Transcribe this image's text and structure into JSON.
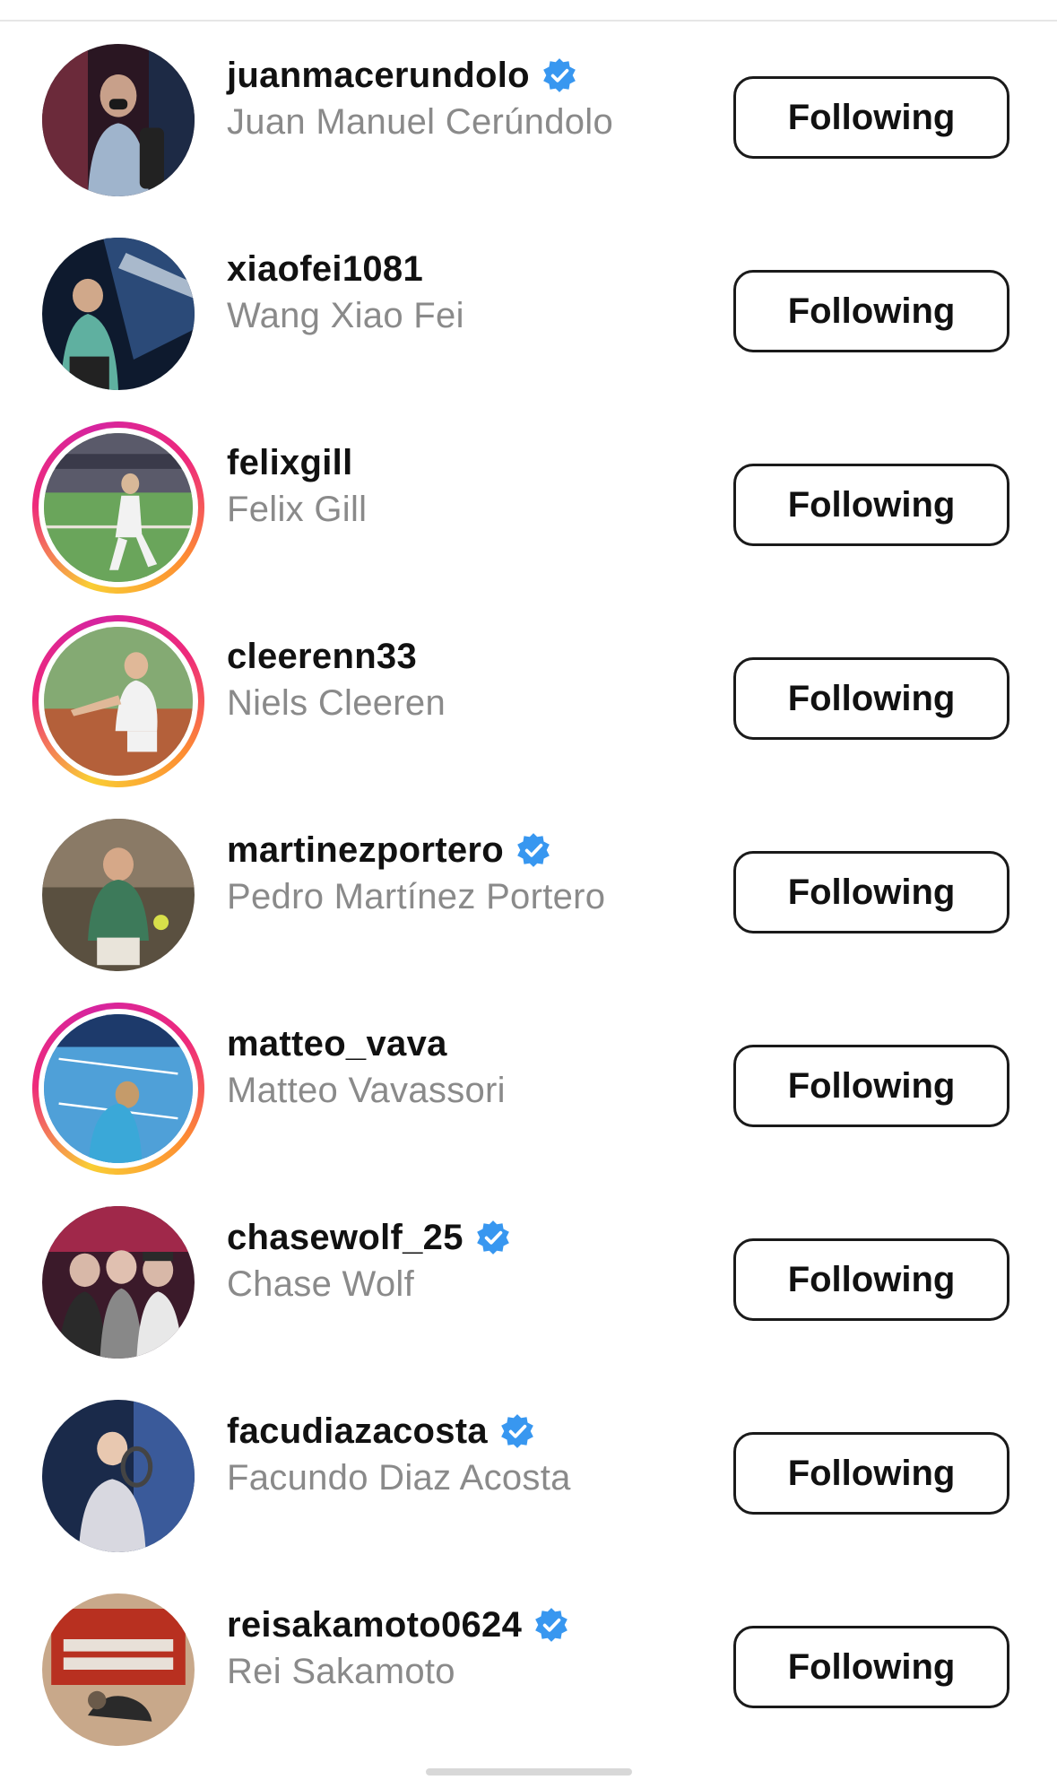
{
  "following_list": [
    {
      "username": "juanmacerundolo",
      "full_name": "Juan Manuel Cerúndolo",
      "verified": true,
      "story_ring": false,
      "button_label": "Following",
      "avatar_colors": [
        "#3a1f2b",
        "#6b3b4a",
        "#b8c6d8",
        "#1d2a45"
      ]
    },
    {
      "username": "xiaofei1081",
      "full_name": "Wang Xiao Fei",
      "verified": false,
      "story_ring": false,
      "button_label": "Following",
      "avatar_colors": [
        "#0e1a2e",
        "#2b4a78",
        "#5fb0a0",
        "#dfe8f0"
      ]
    },
    {
      "username": "felixgill",
      "full_name": "Felix Gill",
      "verified": false,
      "story_ring": true,
      "button_label": "Following",
      "avatar_colors": [
        "#2f6b3a",
        "#6aa55b",
        "#e8e2d8",
        "#5a5a6a"
      ]
    },
    {
      "username": "cleerenn33",
      "full_name": "Niels Cleeren",
      "verified": false,
      "story_ring": true,
      "button_label": "Following",
      "avatar_colors": [
        "#b4603a",
        "#7aa06a",
        "#f2f2f2",
        "#cc8a66"
      ]
    },
    {
      "username": "martinezportero",
      "full_name": "Pedro Martínez Portero",
      "verified": true,
      "story_ring": false,
      "button_label": "Following",
      "avatar_colors": [
        "#5a5040",
        "#3d7a5a",
        "#e9e4da",
        "#8a7a66"
      ]
    },
    {
      "username": "matteo_vava",
      "full_name": "Matteo Vavassori",
      "verified": false,
      "story_ring": true,
      "button_label": "Following",
      "avatar_colors": [
        "#1d3a6b",
        "#2a7ab8",
        "#4fa0d8",
        "#c59b6a"
      ]
    },
    {
      "username": "chasewolf_25",
      "full_name": "Chase Wolf",
      "verified": true,
      "story_ring": false,
      "button_label": "Following",
      "avatar_colors": [
        "#3b1a2a",
        "#a0284a",
        "#d8b8a8",
        "#2a2a2a"
      ]
    },
    {
      "username": "facudiazacosta",
      "full_name": "Facundo Diaz Acosta",
      "verified": true,
      "story_ring": false,
      "button_label": "Following",
      "avatar_colors": [
        "#1a2a4a",
        "#3a5a9a",
        "#e8c8b0",
        "#d8d8e0"
      ]
    },
    {
      "username": "reisakamoto0624",
      "full_name": "Rei Sakamoto",
      "verified": true,
      "story_ring": false,
      "button_label": "Following",
      "avatar_colors": [
        "#b83020",
        "#e8e0d8",
        "#6a5a4a",
        "#c8a88a"
      ]
    }
  ],
  "verified_badge_color": "#3897f0"
}
